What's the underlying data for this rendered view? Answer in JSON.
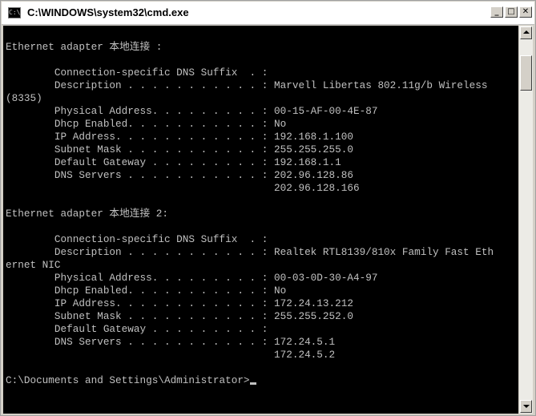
{
  "window": {
    "title": "C:\\WINDOWS\\system32\\cmd.exe",
    "app_icon_glyph": "C:\\",
    "controls": {
      "minimize_glyph": "_",
      "maximize_glyph": "□",
      "close_glyph": "✕"
    }
  },
  "console": {
    "background_color": "#000000",
    "text_color": "#c0c0c0",
    "lines": [
      "Ethernet adapter 本地连接 :",
      "",
      "        Connection-specific DNS Suffix  . :",
      "        Description . . . . . . . . . . . : Marvell Libertas 802.11g/b Wireless",
      "(8335)",
      "        Physical Address. . . . . . . . . : 00-15-AF-00-4E-87",
      "        Dhcp Enabled. . . . . . . . . . . : No",
      "        IP Address. . . . . . . . . . . . : 192.168.1.100",
      "        Subnet Mask . . . . . . . . . . . : 255.255.255.0",
      "        Default Gateway . . . . . . . . . : 192.168.1.1",
      "        DNS Servers . . . . . . . . . . . : 202.96.128.86",
      "                                            202.96.128.166",
      "",
      "Ethernet adapter 本地连接 2:",
      "",
      "        Connection-specific DNS Suffix  . :",
      "        Description . . . . . . . . . . . : Realtek RTL8139/810x Family Fast Eth",
      "ernet NIC",
      "        Physical Address. . . . . . . . . : 00-03-0D-30-A4-97",
      "        Dhcp Enabled. . . . . . . . . . . : No",
      "        IP Address. . . . . . . . . . . . : 172.24.13.212",
      "        Subnet Mask . . . . . . . . . . . : 255.255.252.0",
      "        Default Gateway . . . . . . . . . :",
      "        DNS Servers . . . . . . . . . . . : 172.24.5.1",
      "                                            172.24.5.2",
      "",
      "C:\\Documents and Settings\\Administrator>"
    ]
  },
  "scrollbar": {
    "up_icon": "scroll-up-arrow-icon",
    "down_icon": "scroll-down-arrow-icon"
  }
}
